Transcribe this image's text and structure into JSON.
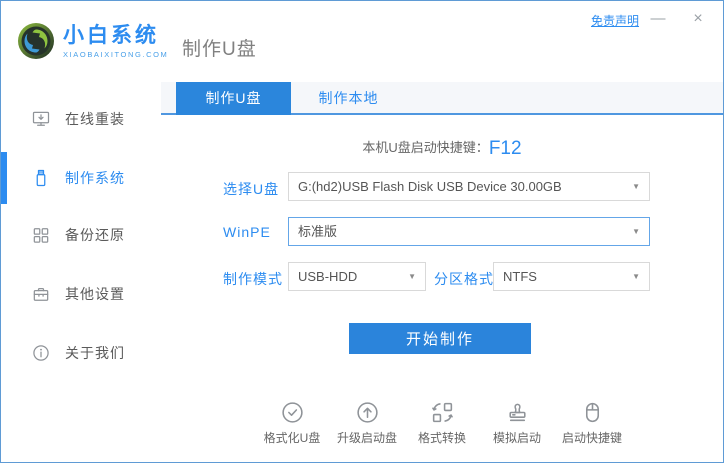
{
  "window": {
    "brand_name": "小白系统",
    "brand_domain": "XIAOBAIXITONG.COM",
    "page_title": "制作U盘",
    "titlebar": {
      "disclaimer": "免责声明",
      "minimize": "—",
      "close": "×"
    }
  },
  "sidebar": {
    "items": [
      {
        "label": "在线重装",
        "icon": "monitor-reinstall-icon",
        "active": false
      },
      {
        "label": "制作系统",
        "icon": "usb-drive-icon",
        "active": true
      },
      {
        "label": "备份还原",
        "icon": "backup-grid-icon",
        "active": false
      },
      {
        "label": "其他设置",
        "icon": "toolbox-icon",
        "active": false
      },
      {
        "label": "关于我们",
        "icon": "info-icon",
        "active": false
      }
    ]
  },
  "tabs": [
    {
      "label": "制作U盘",
      "active": true
    },
    {
      "label": "制作本地",
      "active": false
    }
  ],
  "main": {
    "hotkey_label": "本机U盘启动快捷键：",
    "hotkey_value": "F12",
    "form": {
      "usb_select": {
        "label": "选择U盘",
        "value": "G:(hd2)USB Flash Disk USB Device 30.00GB"
      },
      "winpe": {
        "label": "WinPE",
        "value": "标准版"
      },
      "make_mode": {
        "label": "制作模式",
        "value": "USB-HDD"
      },
      "partition_format": {
        "label": "分区格式",
        "value": "NTFS"
      }
    },
    "start_button": "开始制作",
    "footer_tools": [
      {
        "label": "格式化U盘",
        "icon": "format-usb-icon"
      },
      {
        "label": "升级启动盘",
        "icon": "upgrade-boot-icon"
      },
      {
        "label": "格式转换",
        "icon": "format-convert-icon"
      },
      {
        "label": "模拟启动",
        "icon": "simulate-boot-icon"
      },
      {
        "label": "启动快捷键",
        "icon": "boot-hotkey-icon"
      }
    ]
  },
  "colors": {
    "accent_blue": "#2d8cf0",
    "button_blue": "#2b84db",
    "window_border": "#5f9bd5",
    "logo_green": "#8fc440",
    "logo_blue": "#3e9ad6"
  }
}
